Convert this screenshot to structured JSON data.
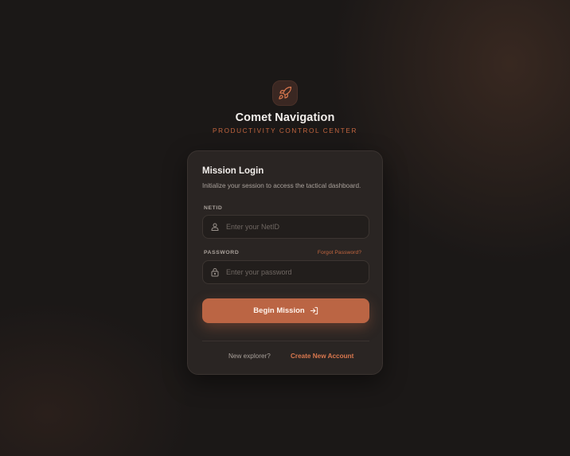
{
  "brand": {
    "title": "Comet Navigation",
    "subtitle": "PRODUCTIVITY CONTROL CENTER",
    "logo_icon": "rocket-icon",
    "accent_color": "#c2653f"
  },
  "login": {
    "title": "Mission Login",
    "description": "Initialize your session to access the tactical dashboard.",
    "netid": {
      "label": "NETID",
      "placeholder": "Enter your NetID",
      "value": "",
      "icon": "user-icon"
    },
    "password": {
      "label": "PASSWORD",
      "placeholder": "Enter your password",
      "value": "",
      "icon": "lock-icon",
      "forgot_label": "Forgot Password?"
    },
    "submit": {
      "label": "Begin Mission",
      "icon": "login-arrow-icon",
      "color": "#bb6544"
    },
    "footer": {
      "prompt": "New explorer?",
      "link_label": "Create New Account"
    }
  }
}
